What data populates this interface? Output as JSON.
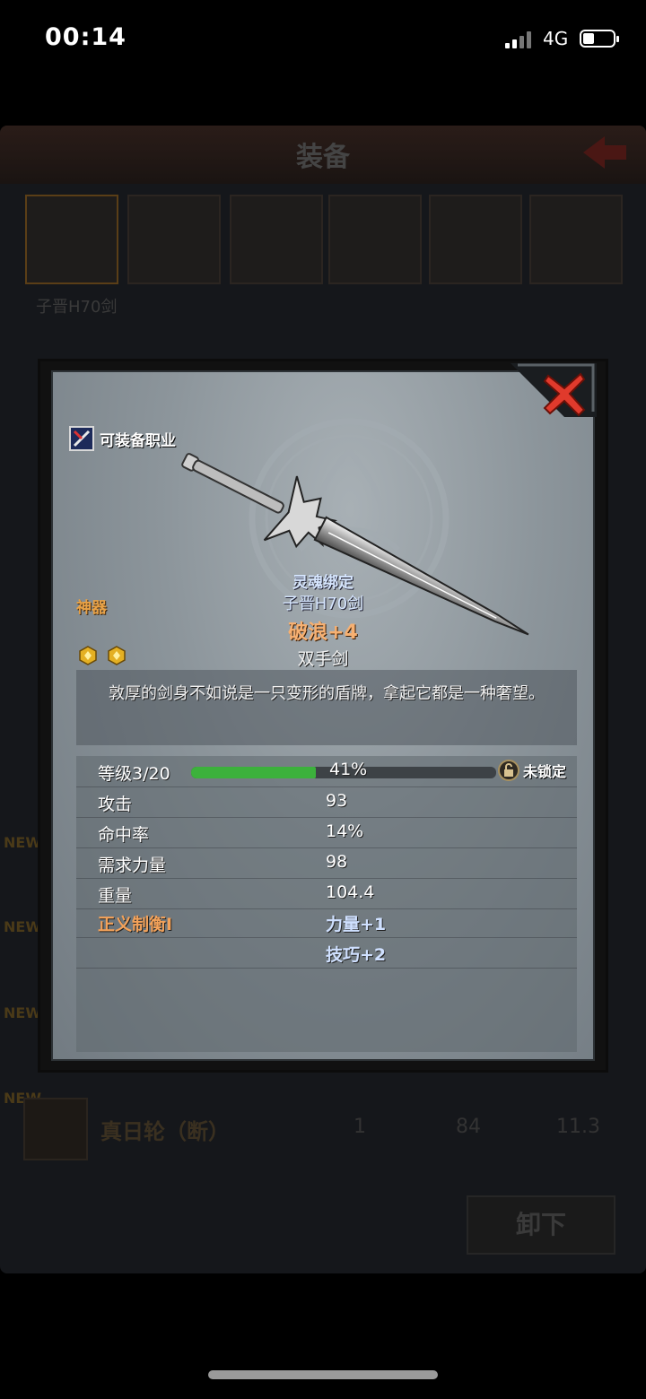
{
  "status_bar": {
    "time": "00:14",
    "network": "4G"
  },
  "background": {
    "title": "装备",
    "selected_item": "子晋H70剑",
    "new_badge": "NEW",
    "row": {
      "name": "真日轮（断）",
      "v1": "1",
      "v2": "84",
      "v3": "11.3"
    },
    "unequip_button": "卸下"
  },
  "item": {
    "equip_class_label": "可装备职业",
    "rarity": "神器",
    "binding": "灵魂绑定",
    "name": "子晋H70剑",
    "enchant": "破浪+4",
    "weapon_type": "双手剑",
    "description": "敦厚的剑身不如说是一只变形的盾牌，拿起它都是一种奢望。",
    "gem_count": 2
  },
  "stats": {
    "level_label": "等级3/20",
    "level_progress_percent": 41,
    "level_progress_text": "41%",
    "lock_label": "未锁定",
    "rows": [
      {
        "label": "攻击",
        "value": "93"
      },
      {
        "label": "命中率",
        "value": "14%"
      },
      {
        "label": "需求力量",
        "value": "98"
      },
      {
        "label": "重量",
        "value": "104.4"
      }
    ],
    "set_name": "正义制衡I",
    "set_bonuses": [
      "力量+1",
      "技巧+2"
    ]
  },
  "colors": {
    "rarity": "#e8a145",
    "enchant": "#f7b071",
    "progress": "#3cb13c",
    "close": "#e03a2c"
  }
}
